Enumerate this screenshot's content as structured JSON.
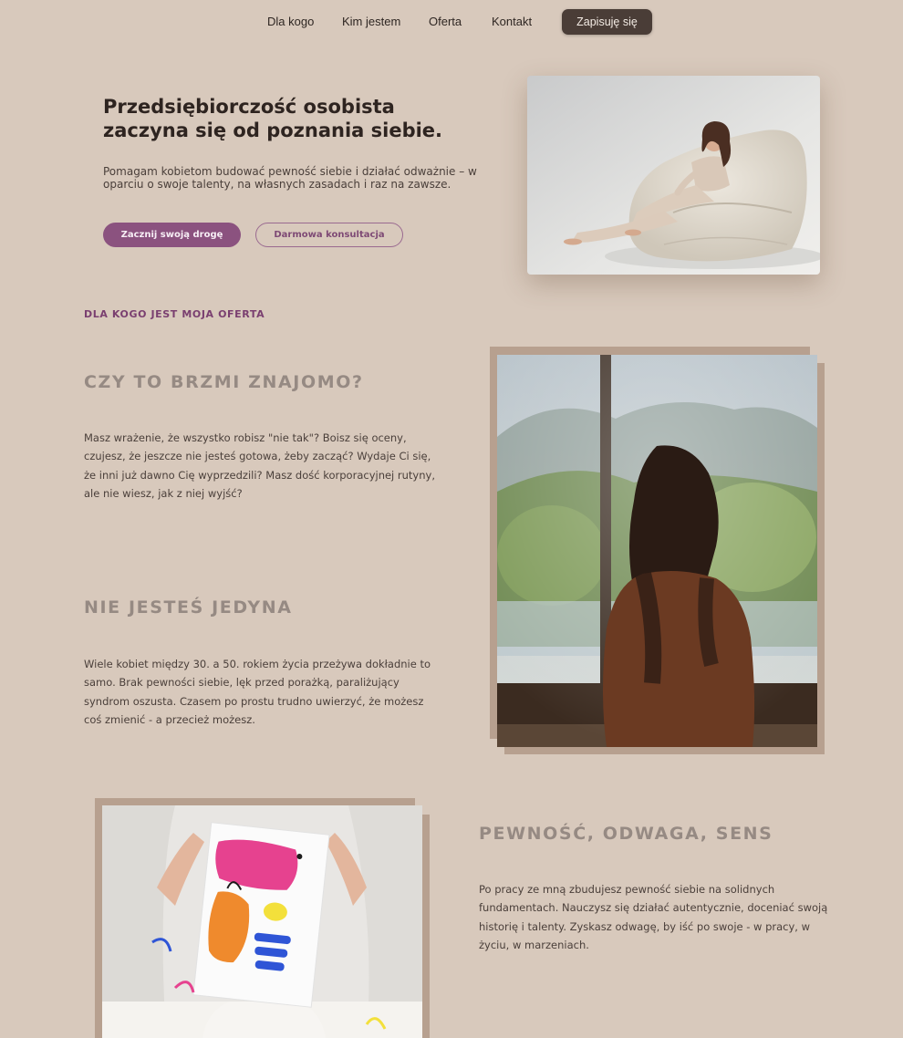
{
  "nav": {
    "links": [
      "Dla kogo",
      "Kim jestem",
      "Oferta",
      "Kontakt"
    ],
    "cta": "Zapisuję się"
  },
  "hero": {
    "title_line1": "Przedsiębiorczość osobista",
    "title_line2": "zaczyna się od poznania siebie.",
    "subtitle": "Pomagam kobietom budować pewność siebie i działać odważnie – w oparciu o swoje talenty, na własnych zasadach i raz na zawsze.",
    "primary_button": "Zacznij swoją drogę",
    "secondary_button": "Darmowa konsultacja"
  },
  "offer": {
    "section_label": "DLA KOGO JEST MOJA OFERTA",
    "block1": {
      "heading": "CZY TO BRZMI ZNAJOMO?",
      "text": "Masz wrażenie, że wszystko robisz \"nie tak\"? Boisz się oceny, czujesz, że jeszcze nie jesteś gotowa, żeby zacząć? Wydaje Ci się, że inni już dawno Cię wyprzedzili? Masz dość korporacyjnej rutyny, ale nie wiesz, jak z niej wyjść?"
    },
    "block2": {
      "heading": "NIE JESTEŚ JEDYNA",
      "text": "Wiele kobiet między 30. a 50. rokiem życia przeżywa dokładnie to samo. Brak pewności siebie, lęk przed porażką, paraliżujący syndrom oszusta. Czasem po prostu trudno uwierzyć, że możesz coś zmienić - a przecież możesz."
    },
    "block3": {
      "heading": "PEWNOŚĆ, ODWAGA, SENS",
      "text": "Po pracy ze mną zbudujesz pewność siebie na solidnych fundamentach. Nauczysz się działać autentycznie, doceniać swoją historię i talenty. Zyskasz odwagę, by iść po swoje - w pracy, w życiu, w marzeniach."
    }
  },
  "colors": {
    "background": "#d8c9bc",
    "accent_purple": "#8b527f",
    "nav_button": "#4a3d37",
    "heading_gray": "#968a83",
    "frame": "#b7a08f"
  }
}
